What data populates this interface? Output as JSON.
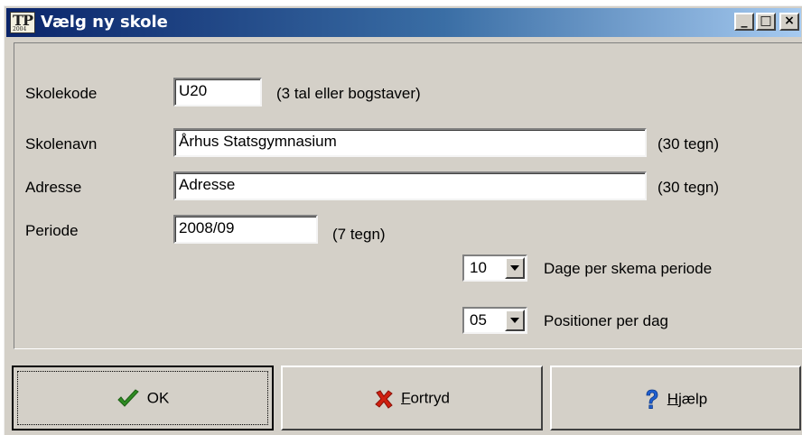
{
  "window": {
    "title": "Vælg ny skole",
    "icon_text": "TP",
    "icon_subtext": "2004",
    "controls": [
      "_",
      "□",
      "×"
    ]
  },
  "form": {
    "skolekode": {
      "label": "Skolekode",
      "value": "U20",
      "hint": "(3 tal eller bogstaver)"
    },
    "skolenavn": {
      "label": "Skolenavn",
      "value": "Århus Statsgymnasium",
      "hint": "(30 tegn)"
    },
    "adresse": {
      "label": "Adresse",
      "value": "Adresse",
      "hint": "(30 tegn)"
    },
    "periode": {
      "label": "Periode",
      "value": "2008/09",
      "hint": "(7 tegn)"
    },
    "dage": {
      "value": "10",
      "label": "Dage per skema periode"
    },
    "positioner": {
      "value": "05",
      "label": "Positioner per dag"
    }
  },
  "buttons": {
    "ok": {
      "label": "OK",
      "icon": "checkmark-icon",
      "icon_color": "#2e8b22"
    },
    "fortryd": {
      "mnemonic": "F",
      "rest": "ortryd",
      "icon": "red-x-icon",
      "icon_color": "#d02010"
    },
    "hjaelp": {
      "mnemonic": "H",
      "rest": "jælp",
      "icon": "question-icon",
      "icon_color": "#1f5fd0"
    }
  }
}
